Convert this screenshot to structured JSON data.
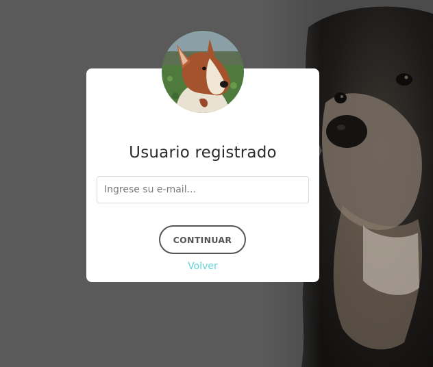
{
  "login_card": {
    "title": "Usuario registrado",
    "email_placeholder": "Ingrese su e-mail...",
    "email_value": "",
    "continue_label": "CONTINUAR",
    "back_label": "Volver"
  },
  "colors": {
    "backdrop": "#5a5a5a",
    "card": "#ffffff",
    "link_accent": "#5fd3d6",
    "button_border": "#555555"
  }
}
